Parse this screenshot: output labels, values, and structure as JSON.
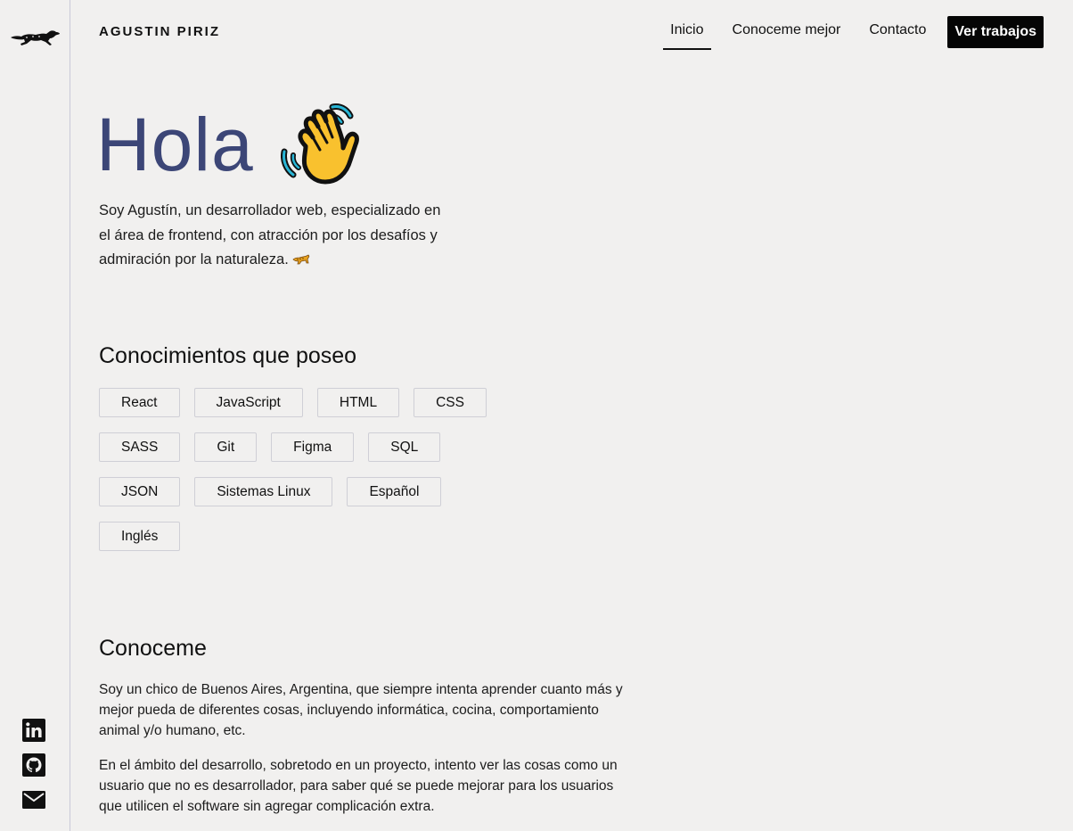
{
  "header": {
    "brand": "AGUSTIN PIRIZ",
    "nav": [
      {
        "label": "Inicio",
        "active": true
      },
      {
        "label": "Conoceme mejor",
        "active": false
      },
      {
        "label": "Contacto",
        "active": false
      }
    ],
    "cta_label": "Ver trabajos"
  },
  "rail": {
    "logo_icon": "running-leopard-icon",
    "social": [
      "linkedin-icon",
      "github-icon",
      "mail-icon"
    ]
  },
  "hero": {
    "title": "Hola",
    "wave_icon": "waving-hand-emoji",
    "intro": "Soy Agustín, un desarrollador web, especializado en el área de frontend, con atracción por los desafíos y admiración por la naturaleza.",
    "intro_icon": "leopard-emoji"
  },
  "skills": {
    "title": "Conocimientos que poseo",
    "items": [
      "React",
      "JavaScript",
      "HTML",
      "CSS",
      "SASS",
      "Git",
      "Figma",
      "SQL",
      "JSON",
      "Sistemas Linux",
      "Español",
      "Inglés"
    ]
  },
  "about": {
    "title": "Conoceme",
    "paragraphs": [
      "Soy un chico de Buenos Aires, Argentina, que siempre intenta aprender cuanto más y mejor pueda de diferentes cosas, incluyendo informática, cocina, comportamiento animal y/o humano, etc.",
      "En el ámbito del desarrollo, sobretodo en un proyecto, intento ver las cosas como un usuario que no es desarrollador, para saber qué se puede mejorar para los usuarios que utilicen el software sin agregar complicación extra."
    ]
  },
  "colors": {
    "background": "#f1f0ef",
    "hero_title": "#3c4677",
    "cta_background": "#050505",
    "rail_border": "#c9c9d8"
  }
}
